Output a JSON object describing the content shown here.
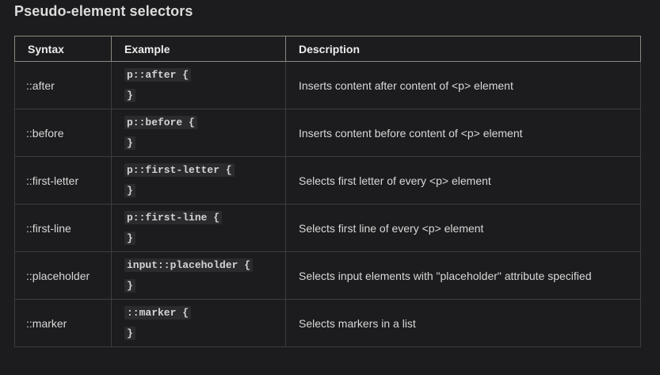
{
  "section": {
    "title": "Pseudo-element selectors"
  },
  "table": {
    "headers": [
      "Syntax",
      "Example",
      "Description"
    ],
    "rows": [
      {
        "syntax": "::after",
        "example_open": "p::after {",
        "example_close": "}",
        "description": "Inserts content after content of <p> element"
      },
      {
        "syntax": "::before",
        "example_open": "p::before {",
        "example_close": "}",
        "description": "Inserts content before content of <p> element"
      },
      {
        "syntax": "::first-letter",
        "example_open": "p::first-letter {",
        "example_close": "}",
        "description": "Selects first letter of every <p> element"
      },
      {
        "syntax": "::first-line",
        "example_open": "p::first-line {",
        "example_close": "}",
        "description": "Selects first line of every <p> element"
      },
      {
        "syntax": "::placeholder",
        "example_open": "input::placeholder {",
        "example_close": "}",
        "description": "Selects input elements with \"placeholder\" attribute specified"
      },
      {
        "syntax": "::marker",
        "example_open": "::marker {",
        "example_close": "}",
        "description": "Selects markers in a list"
      }
    ]
  },
  "colors": {
    "background": "#1c1c1e",
    "border": "#3d3d3f",
    "header_border": "#8a8a82",
    "code_background": "#2b2b2d"
  }
}
